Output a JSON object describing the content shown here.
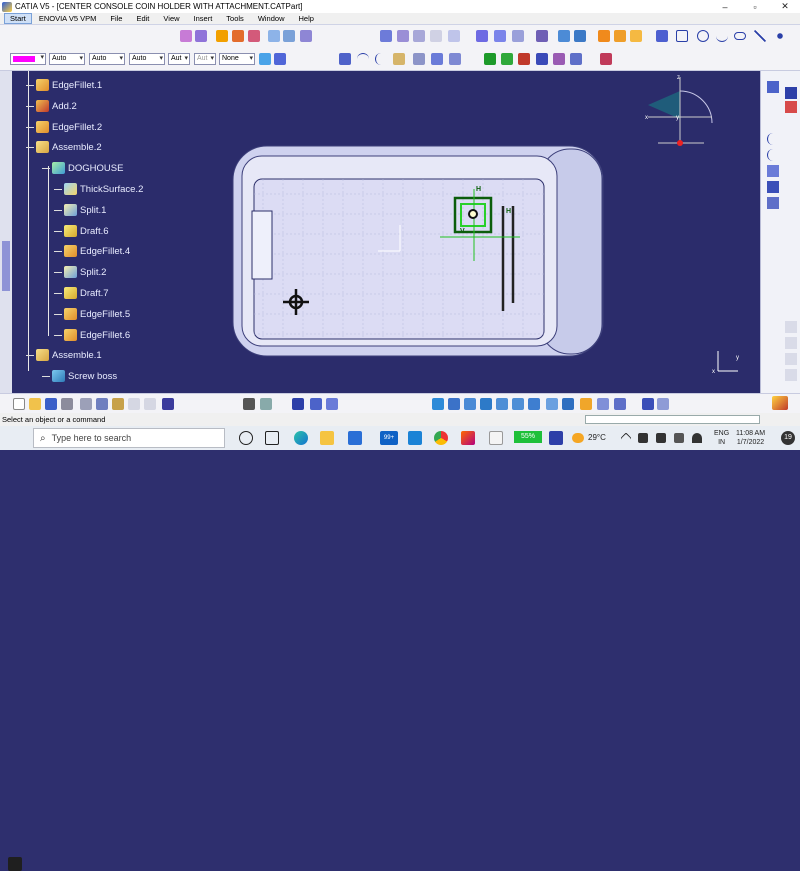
{
  "window": {
    "title": "CATIA V5 - [CENTER CONSOLE COIN HOLDER WITH ATTACHMENT.CATPart]",
    "minimize": "–",
    "restore": "▫",
    "close": "✕"
  },
  "menu": {
    "items": [
      "Start",
      "ENOVIA V5 VPM",
      "File",
      "Edit",
      "View",
      "Insert",
      "Tools",
      "Window",
      "Help"
    ]
  },
  "toolbar": {
    "color_swatch": "#ff00ff",
    "dropdowns": [
      "Auto",
      "Auto",
      "Auto",
      "Aut",
      "Aut",
      "None"
    ]
  },
  "tree": {
    "nodes": [
      {
        "label": "EdgeFillet.1",
        "icon": "edgefillet-icon"
      },
      {
        "label": "Add.2",
        "icon": "add-icon"
      },
      {
        "label": "EdgeFillet.2",
        "icon": "edgefillet-icon"
      },
      {
        "label": "Assemble.2",
        "icon": "assemble-icon"
      },
      {
        "label": "DOGHOUSE",
        "icon": "doghouse-icon"
      },
      {
        "label": "ThickSurface.2",
        "icon": "thicksurface-icon"
      },
      {
        "label": "Split.1",
        "icon": "split-icon"
      },
      {
        "label": "Draft.6",
        "icon": "draft-icon"
      },
      {
        "label": "EdgeFillet.4",
        "icon": "edgefillet-icon"
      },
      {
        "label": "Split.2",
        "icon": "split-icon"
      },
      {
        "label": "Draft.7",
        "icon": "draft-icon"
      },
      {
        "label": "EdgeFillet.5",
        "icon": "edgefillet-icon"
      },
      {
        "label": "EdgeFillet.6",
        "icon": "edgefillet-icon"
      },
      {
        "label": "Assemble.1",
        "icon": "assemble-icon"
      },
      {
        "label": "Screw boss",
        "icon": "screwboss-icon"
      }
    ]
  },
  "compass": {
    "x": "x",
    "y": "y",
    "z": "z"
  },
  "axis": {
    "x": "x",
    "y": "y"
  },
  "sketch_labels": {
    "h1": "H",
    "h2": "H",
    "v1": "V"
  },
  "status": {
    "message": "Select an object or a command"
  },
  "taskbar": {
    "search_placeholder": "Type here to search",
    "badge": "99+",
    "battery": "55%",
    "temperature": "29°C",
    "language": "ENG",
    "region": "IN",
    "time": "11:08 AM",
    "date": "1/7/2022",
    "notifications": "19"
  },
  "brand": {
    "catia_logo": "CATIA"
  }
}
